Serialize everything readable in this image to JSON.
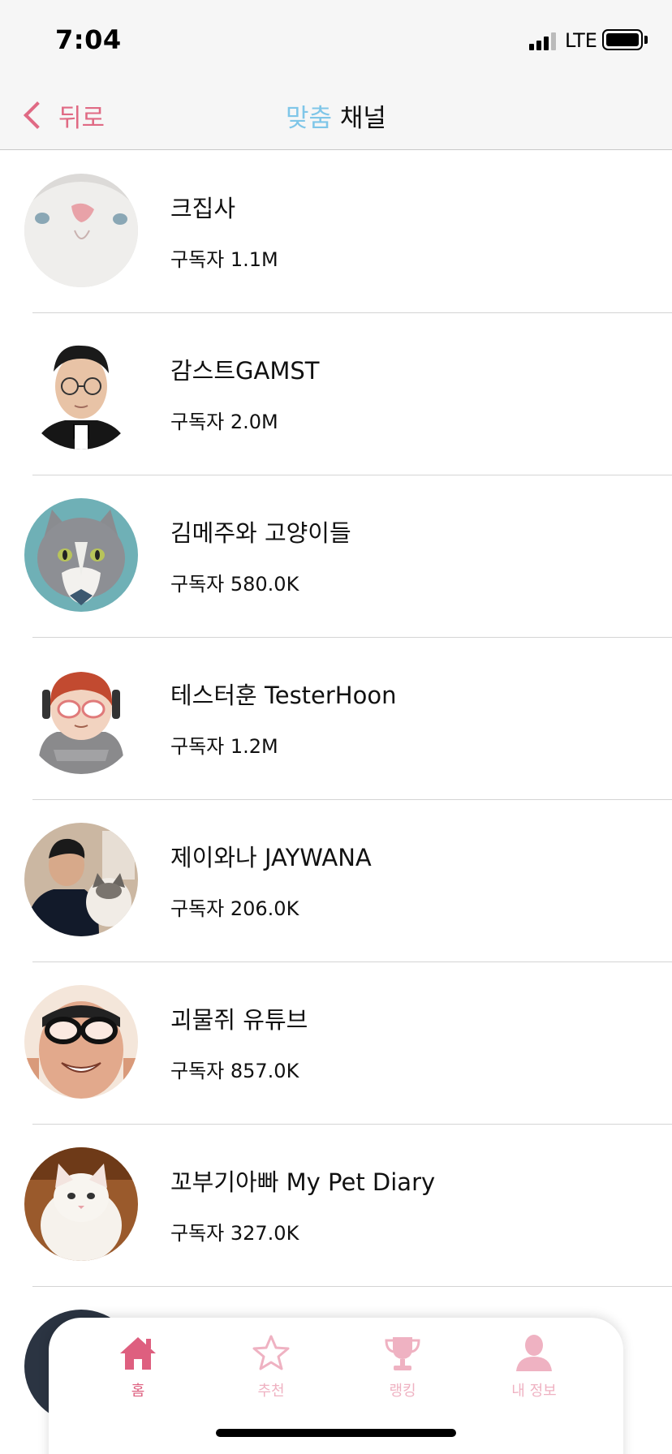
{
  "status_bar": {
    "time": "7:04",
    "network": "LTE"
  },
  "nav": {
    "back_label": "뒤로",
    "title_accent": "맞춤",
    "title_rest": " 채널",
    "accent_color": "#e06a84",
    "title_accent_color": "#7fc6e8"
  },
  "channels": [
    {
      "name": "크집사",
      "subscribers": "구독자 1.1M",
      "avatar": "white-cat-closeup"
    },
    {
      "name": "감스트GAMST",
      "subscribers": "구독자 2.0M",
      "avatar": "man-with-glasses-bowtie"
    },
    {
      "name": "김메주와 고양이들",
      "subscribers": "구독자 580.0K",
      "avatar": "gray-cat-teal-background"
    },
    {
      "name": "테스터훈 TesterHoon",
      "subscribers": "구독자 1.2M",
      "avatar": "cartoon-character-headphones"
    },
    {
      "name": "제이와나 JAYWANA",
      "subscribers": "구독자 206.0K",
      "avatar": "man-with-cat"
    },
    {
      "name": "괴물쥐 유튜브",
      "subscribers": "구독자 857.0K",
      "avatar": "man-with-goggles"
    },
    {
      "name": "꼬부기아빠 My Pet Diary",
      "subscribers": "구독자 327.0K",
      "avatar": "white-kitten"
    }
  ],
  "tabs": [
    {
      "label": "홈",
      "icon": "home-icon",
      "active": true
    },
    {
      "label": "추천",
      "icon": "star-icon",
      "active": false
    },
    {
      "label": "랭킹",
      "icon": "trophy-icon",
      "active": false
    },
    {
      "label": "내 정보",
      "icon": "person-icon",
      "active": false
    }
  ]
}
